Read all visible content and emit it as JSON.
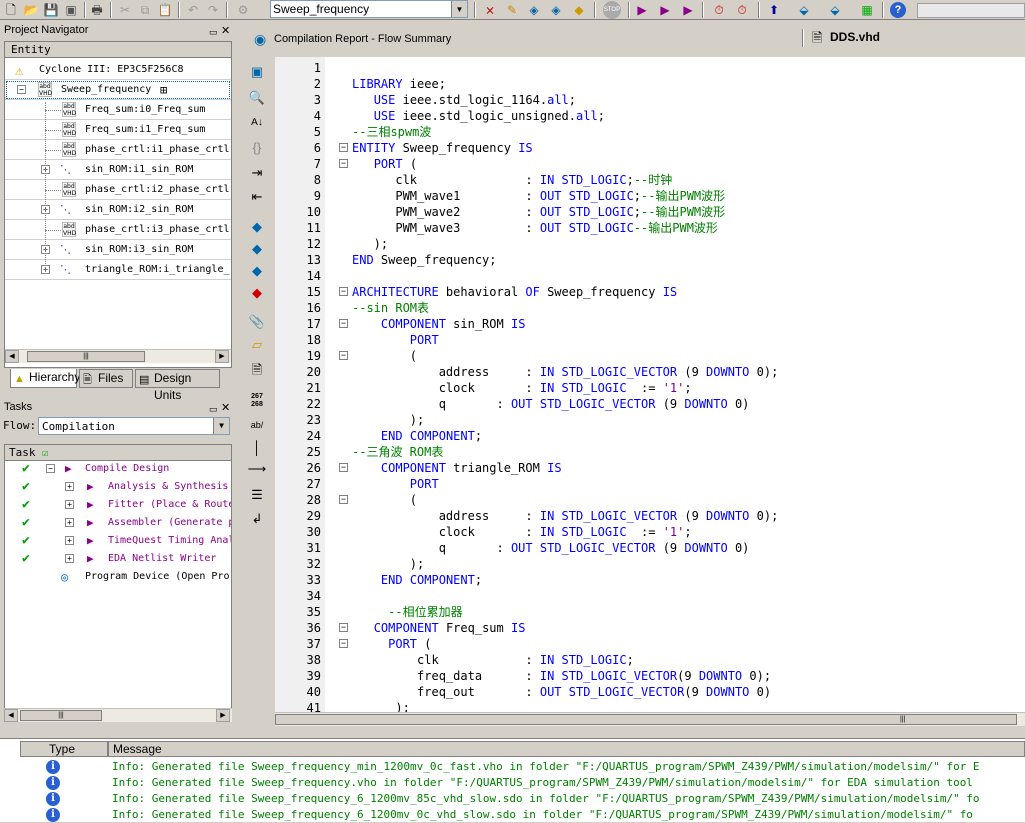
{
  "toolbar": {
    "entity_combo": "Sweep_frequency",
    "icons": [
      "new-icon",
      "open-icon",
      "save-icon",
      "save-all-icon",
      "print-icon",
      "cut-icon",
      "copy-icon",
      "paste-icon",
      "undo-icon",
      "redo-icon",
      "settings-icon",
      "pin-planner-icon",
      "assignment-editor-icon",
      "chip-planner-icon",
      "stop-icon",
      "start-compilation-icon",
      "analysis-icon",
      "fitter-icon",
      "timing-icon",
      "timequest-icon",
      "rtl-viewer-icon",
      "programmer-icon",
      "signaltap-icon",
      "chip-icon",
      "help-icon"
    ]
  },
  "project_navigator": {
    "title": "Project Navigator",
    "column_header": "Entity",
    "device": "Cyclone III: EP3C5F256C8",
    "top_entity": "Sweep_frequency",
    "items": [
      {
        "label": "Freq_sum:i0_Freq_sum",
        "expandable": false
      },
      {
        "label": "Freq_sum:i1_Freq_sum",
        "expandable": false
      },
      {
        "label": "phase_crtl:i1_phase_crtl",
        "expandable": false
      },
      {
        "label": "sin_ROM:i1_sin_ROM",
        "expandable": true
      },
      {
        "label": "phase_crtl:i2_phase_crtl",
        "expandable": false
      },
      {
        "label": "sin_ROM:i2_sin_ROM",
        "expandable": true
      },
      {
        "label": "phase_crtl:i3_phase_crtl",
        "expandable": false
      },
      {
        "label": "sin_ROM:i3_sin_ROM",
        "expandable": true
      },
      {
        "label": "triangle_ROM:i_triangle_",
        "expandable": true
      }
    ],
    "tabs": [
      "Hierarchy",
      "Files",
      "Design Units"
    ]
  },
  "tasks": {
    "title": "Tasks",
    "flow_label": "Flow:",
    "flow_value": "Compilation",
    "column_header": "Task",
    "rows": [
      {
        "label": "Compile Design",
        "done": true,
        "indent": 0
      },
      {
        "label": "Analysis & Synthesis",
        "done": true,
        "indent": 1
      },
      {
        "label": "Fitter (Place & Route",
        "done": true,
        "indent": 1
      },
      {
        "label": "Assembler (Generate p",
        "done": true,
        "indent": 1
      },
      {
        "label": "TimeQuest Timing Anal",
        "done": true,
        "indent": 1
      },
      {
        "label": "EDA Netlist Writer",
        "done": true,
        "indent": 1
      },
      {
        "label": "Program Device (Open Pro",
        "done": false,
        "indent": 0
      }
    ]
  },
  "editor": {
    "tabs": [
      {
        "label": "Compilation Report - Flow Summary",
        "active": false
      },
      {
        "label": "DDS.vhd",
        "active": true
      }
    ],
    "lines": [
      {
        "n": "1",
        "text": ""
      },
      {
        "n": "2",
        "text": "LIBRARY ieee;"
      },
      {
        "n": "3",
        "text": "   USE ieee.std_logic_1164.all;"
      },
      {
        "n": "4",
        "text": "   USE ieee.std_logic_unsigned.all;"
      },
      {
        "n": "5",
        "text": "--三相spwm波"
      },
      {
        "n": "6",
        "text": "ENTITY Sweep_frequency IS"
      },
      {
        "n": "7",
        "text": "   PORT ("
      },
      {
        "n": "8",
        "text": "      clk               : IN STD_LOGIC;--时钟"
      },
      {
        "n": "9",
        "text": "      PWM_wave1         : OUT STD_LOGIC;--输出PWM波形"
      },
      {
        "n": "10",
        "text": "      PWM_wave2         : OUT STD_LOGIC;--输出PWM波形"
      },
      {
        "n": "11",
        "text": "      PWM_wave3         : OUT STD_LOGIC--输出PWM波形"
      },
      {
        "n": "12",
        "text": "   );"
      },
      {
        "n": "13",
        "text": "END Sweep_frequency;"
      },
      {
        "n": "14",
        "text": ""
      },
      {
        "n": "15",
        "text": "ARCHITECTURE behavioral OF Sweep_frequency IS"
      },
      {
        "n": "16",
        "text": "--sin ROM表"
      },
      {
        "n": "17",
        "text": "    COMPONENT sin_ROM IS"
      },
      {
        "n": "18",
        "text": "        PORT"
      },
      {
        "n": "19",
        "text": "        ("
      },
      {
        "n": "20",
        "text": "            address     : IN STD_LOGIC_VECTOR (9 DOWNTO 0);"
      },
      {
        "n": "21",
        "text": "            clock       : IN STD_LOGIC  := '1';"
      },
      {
        "n": "22",
        "text": "            q       : OUT STD_LOGIC_VECTOR (9 DOWNTO 0)"
      },
      {
        "n": "23",
        "text": "        );"
      },
      {
        "n": "24",
        "text": "    END COMPONENT;"
      },
      {
        "n": "25",
        "text": "--三角波 ROM表"
      },
      {
        "n": "26",
        "text": "    COMPONENT triangle_ROM IS"
      },
      {
        "n": "27",
        "text": "        PORT"
      },
      {
        "n": "28",
        "text": "        ("
      },
      {
        "n": "29",
        "text": "            address     : IN STD_LOGIC_VECTOR (9 DOWNTO 0);"
      },
      {
        "n": "30",
        "text": "            clock       : IN STD_LOGIC  := '1';"
      },
      {
        "n": "31",
        "text": "            q       : OUT STD_LOGIC_VECTOR (9 DOWNTO 0)"
      },
      {
        "n": "32",
        "text": "        );"
      },
      {
        "n": "33",
        "text": "    END COMPONENT;"
      },
      {
        "n": "34",
        "text": ""
      },
      {
        "n": "35",
        "text": "     --相位累加器"
      },
      {
        "n": "36",
        "text": "   COMPONENT Freq_sum IS"
      },
      {
        "n": "37",
        "text": "     PORT ("
      },
      {
        "n": "38",
        "text": "         clk            : IN STD_LOGIC;"
      },
      {
        "n": "39",
        "text": "         freq_data      : IN STD_LOGIC_VECTOR(9 DOWNTO 0);"
      },
      {
        "n": "40",
        "text": "         freq_out       : OUT STD_LOGIC_VECTOR(9 DOWNTO 0)"
      },
      {
        "n": "41",
        "text": "      );"
      }
    ]
  },
  "messages": {
    "col_type": "Type",
    "col_message": "Message",
    "rows": [
      "Info: Generated file Sweep_frequency_min_1200mv_0c_fast.vho in folder \"F:/QUARTUS_program/SPWM_Z439/PWM/simulation/modelsim/\" for E",
      "Info: Generated file Sweep_frequency.vho in folder \"F:/QUARTUS_program/SPWM_Z439/PWM/simulation/modelsim/\" for EDA simulation tool",
      "Info: Generated file Sweep_frequency_6_1200mv_85c_vhd_slow.sdo in folder \"F:/QUARTUS_program/SPWM_Z439/PWM/simulation/modelsim/\" fo",
      "Info: Generated file Sweep_frequency_6_1200mv_0c_vhd_slow.sdo in folder \"F:/QUARTUS_program/SPWM_Z439/PWM/simulation/modelsim/\" fo"
    ]
  },
  "colors": {
    "keyword": "#0000ff",
    "comment": "#008000",
    "string": "#800080",
    "message": "#008000",
    "check": "#00a000"
  }
}
